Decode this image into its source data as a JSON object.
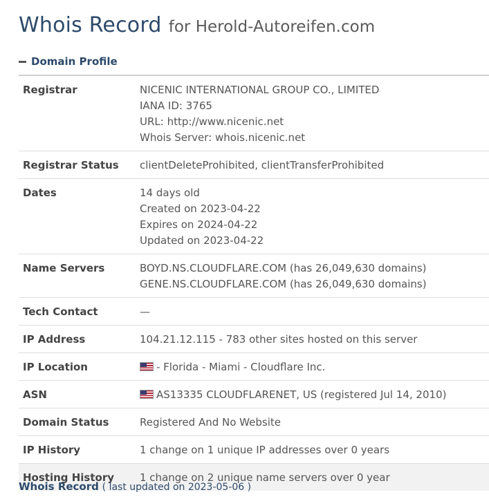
{
  "header": {
    "title_main": "Whois Record",
    "title_sub": "for Herold-Autoreifen.com"
  },
  "section": {
    "label": "Domain Profile"
  },
  "rows": {
    "registrar": {
      "label": "Registrar",
      "lines": [
        "NICENIC INTERNATIONAL GROUP CO., LIMITED",
        "IANA ID: 3765",
        "URL: http://www.nicenic.net",
        "Whois Server: whois.nicenic.net"
      ]
    },
    "registrar_status": {
      "label": "Registrar Status",
      "value": "clientDeleteProhibited, clientTransferProhibited"
    },
    "dates": {
      "label": "Dates",
      "lines": [
        "14 days old",
        "Created on 2023-04-22",
        "Expires on 2024-04-22",
        "Updated on 2023-04-22"
      ]
    },
    "name_servers": {
      "label": "Name Servers",
      "lines": [
        "BOYD.NS.CLOUDFLARE.COM (has 26,049,630 domains)",
        "GENE.NS.CLOUDFLARE.COM (has 26,049,630 domains)"
      ]
    },
    "tech_contact": {
      "label": "Tech Contact",
      "value": "—"
    },
    "ip_address": {
      "label": "IP Address",
      "value": "104.21.12.115 - 783 other sites hosted on this server"
    },
    "ip_location": {
      "label": "IP Location",
      "value": "- Florida - Miami - Cloudflare Inc."
    },
    "asn": {
      "label": "ASN",
      "value": "AS13335 CLOUDFLARENET, US (registered Jul 14, 2010)"
    },
    "domain_status": {
      "label": "Domain Status",
      "value": "Registered And No Website"
    },
    "ip_history": {
      "label": "IP History",
      "value": "1 change on 1 unique IP addresses over 0 years"
    },
    "hosting_history": {
      "label": "Hosting History",
      "value": "1 change on 2 unique name servers over 0 year"
    }
  },
  "footer": {
    "title": "Whois Record",
    "note": "( last updated on 2023-05-06 )"
  },
  "icons": {
    "section_toggle": "minus-icon",
    "flag": "us-flag-icon"
  },
  "colors": {
    "title": "#2d4a6b",
    "shaded_row": "#f2f2f2"
  }
}
